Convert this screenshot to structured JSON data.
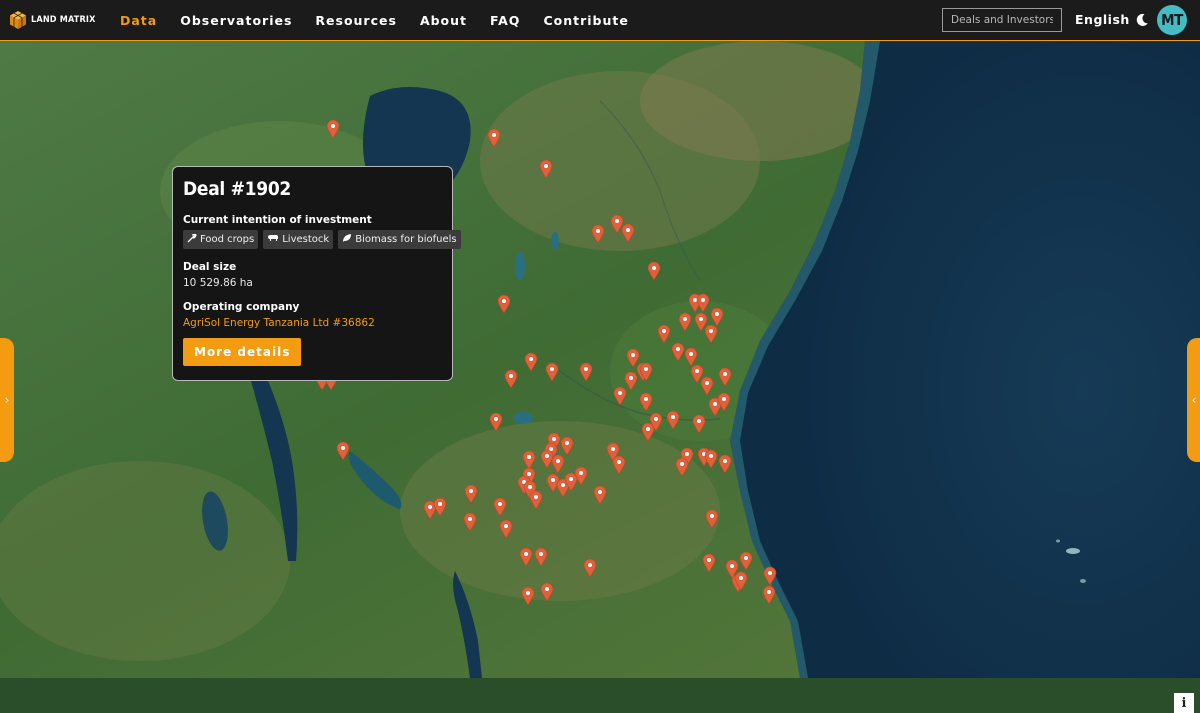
{
  "brand": {
    "name": "LAND MATRIX"
  },
  "nav": {
    "items": [
      {
        "label": "Data",
        "active": true
      },
      {
        "label": "Observatories",
        "active": false
      },
      {
        "label": "Resources",
        "active": false
      },
      {
        "label": "About",
        "active": false
      },
      {
        "label": "FAQ",
        "active": false
      },
      {
        "label": "Contribute",
        "active": false
      }
    ],
    "search_placeholder": "Deals and Investors",
    "language": "English",
    "user_initials": "MT"
  },
  "popup": {
    "title": "Deal #1902",
    "intention_label": "Current intention of investment",
    "tags": [
      "Food crops",
      "Livestock",
      "Biomass for biofuels"
    ],
    "size_label": "Deal size",
    "size_value": "10 529.86 ha",
    "company_label": "Operating company",
    "company_value": "AgriSol Energy Tanzania Ltd #36862",
    "more_button": "More details"
  },
  "map": {
    "info_button": "i",
    "marker_color": "#e0603a",
    "accent_color": "#f39c12"
  }
}
